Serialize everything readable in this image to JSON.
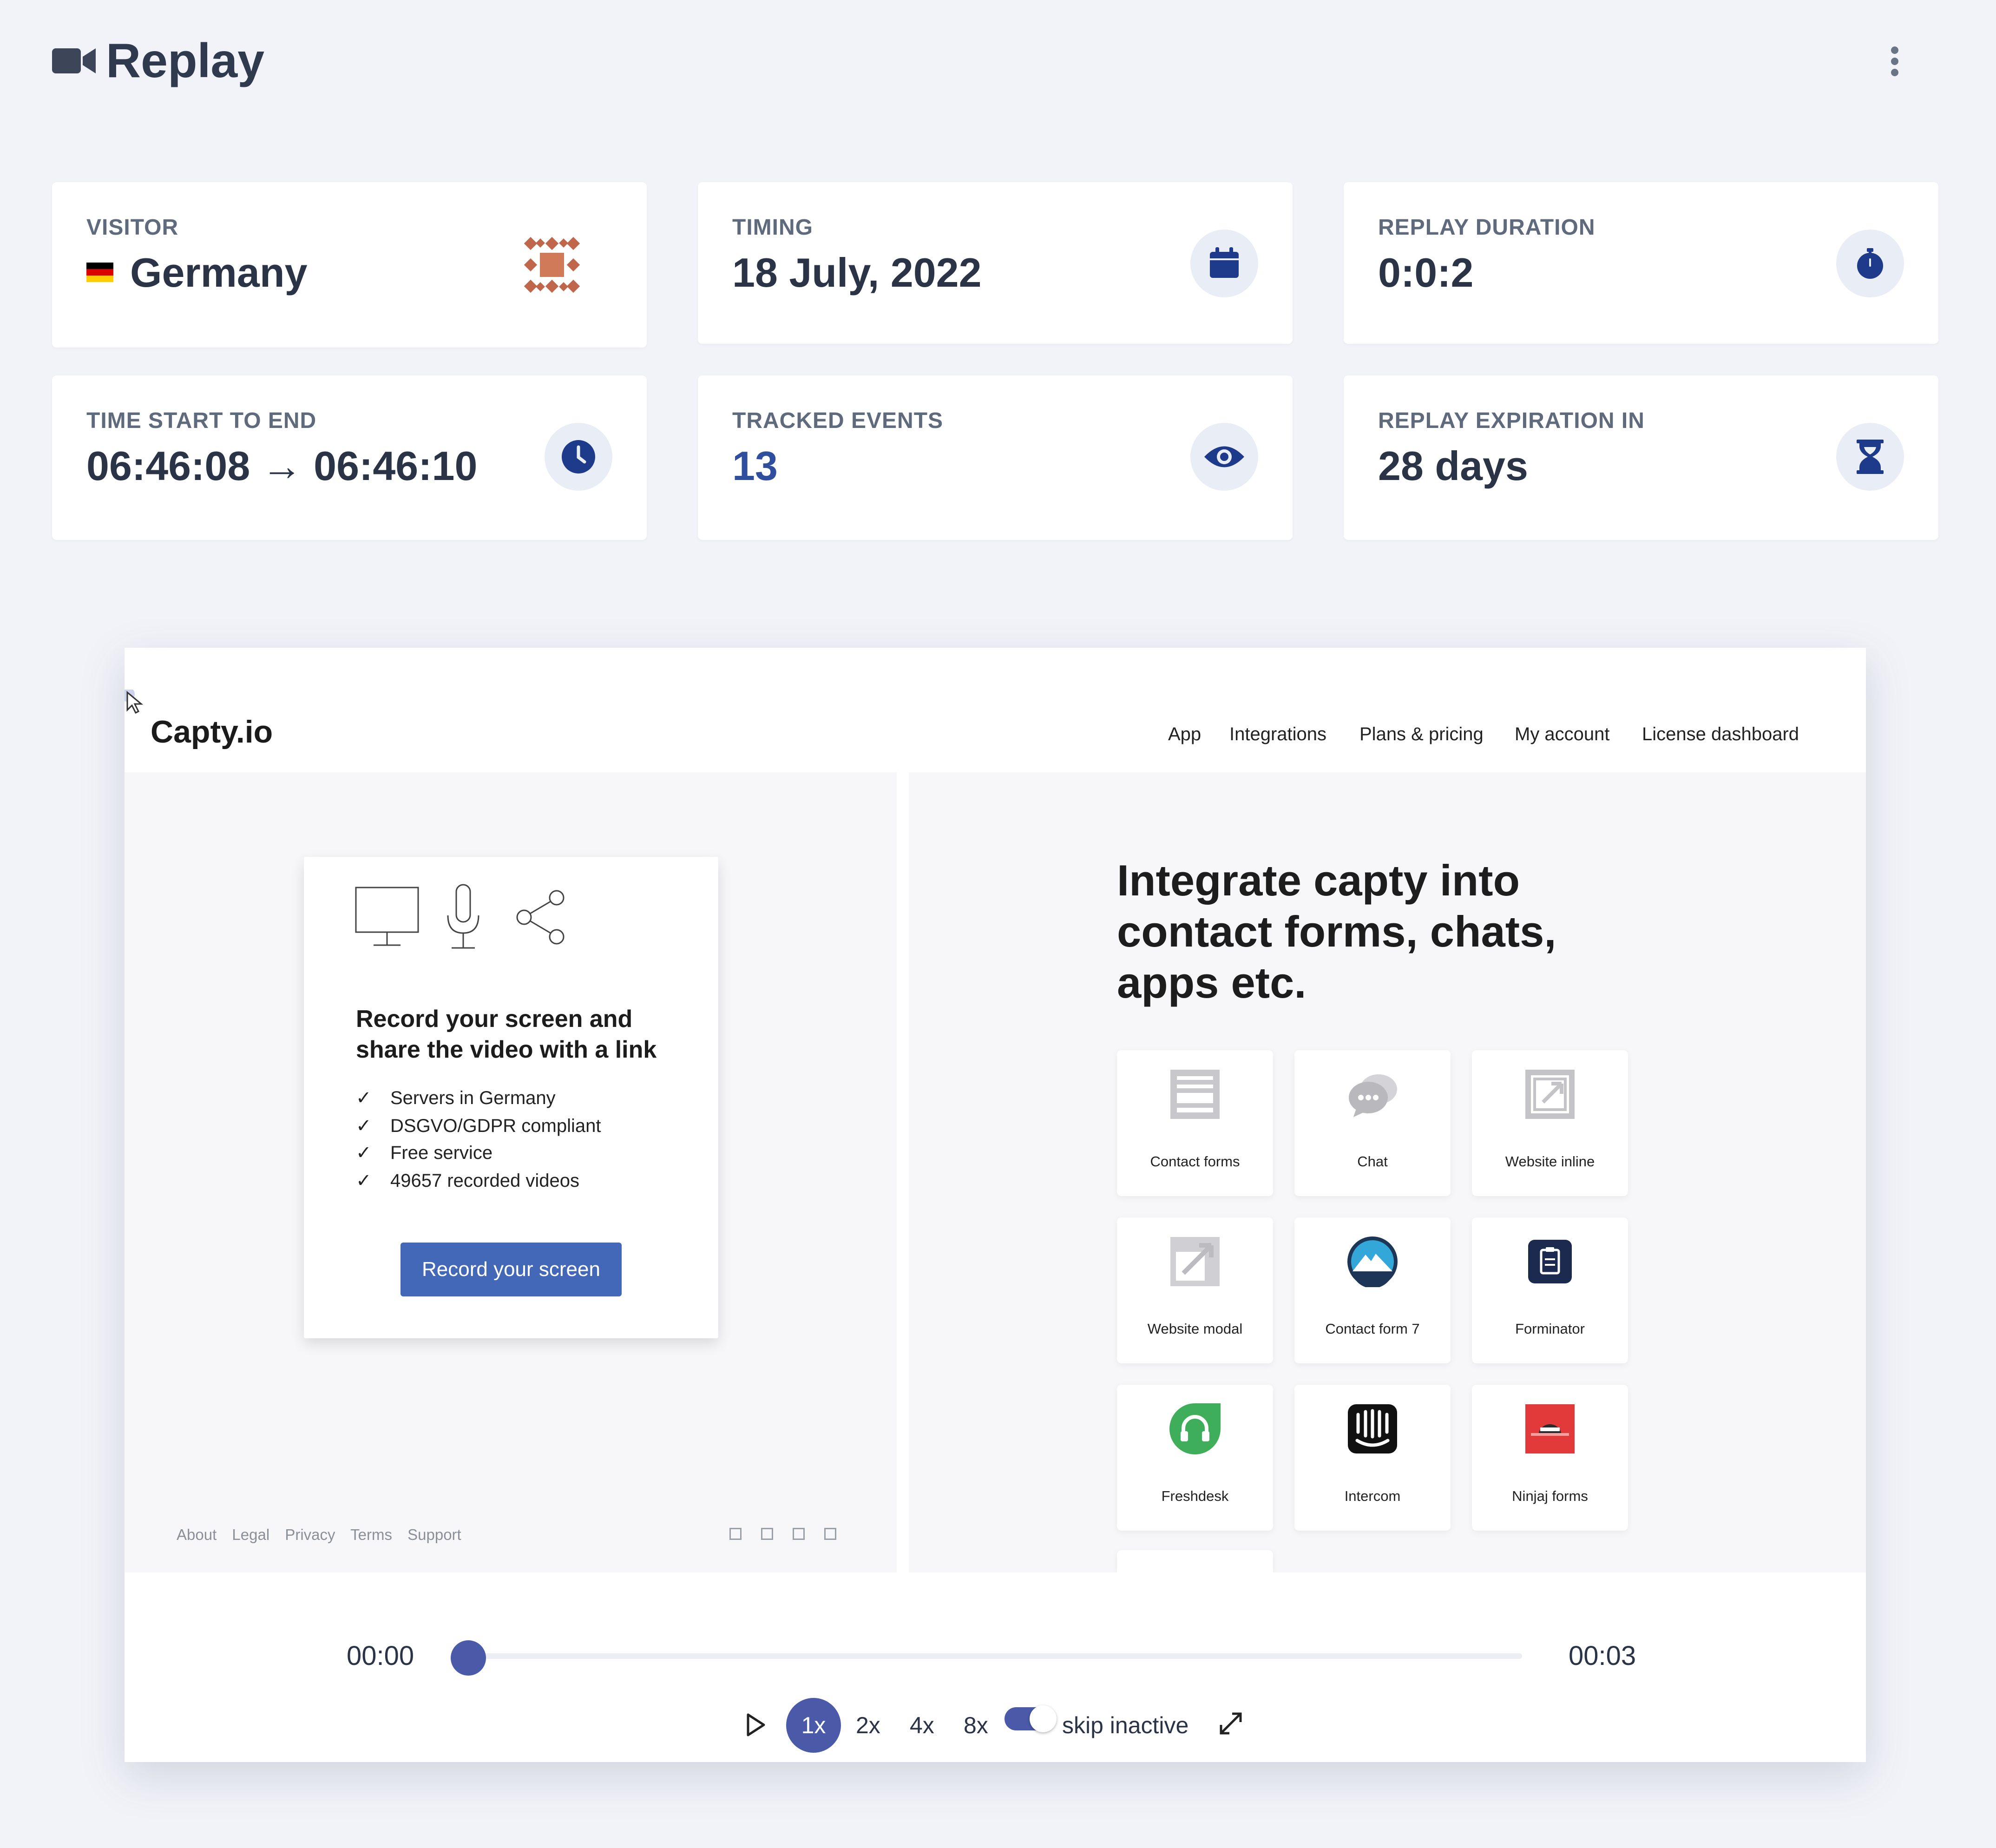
{
  "header": {
    "title": "Replay",
    "icon": "video-camera-icon",
    "menu_icon": "kebab-menu-icon"
  },
  "stats": [
    {
      "label": "VISITOR",
      "value": "Germany",
      "icon": "visitor-avatar-icon",
      "flag": "germany-flag-icon"
    },
    {
      "label": "TIMING",
      "value": "18 July, 2022",
      "icon": "calendar-icon"
    },
    {
      "label": "REPLAY DURATION",
      "value": "0:0:2",
      "icon": "stopwatch-icon"
    },
    {
      "label": "TIME START TO END",
      "value": "06:46:08 → 06:46:10",
      "icon": "clock-icon"
    },
    {
      "label": "TRACKED EVENTS",
      "value": "13",
      "icon": "eye-icon"
    },
    {
      "label": "REPLAY EXPIRATION IN",
      "value": "28 days",
      "icon": "hourglass-icon"
    }
  ],
  "site": {
    "logo": "Capty.io",
    "nav": [
      "App",
      "Integrations",
      "Plans & pricing",
      "My account",
      "License dashboard"
    ],
    "promo": {
      "title": "Record your screen and share the video with a link",
      "checks": [
        "Servers in Germany",
        "DSGVO/GDPR compliant",
        "Free service",
        "49657 recorded videos"
      ],
      "button": "Record your screen"
    },
    "footer_links": [
      "About",
      "Legal",
      "Privacy",
      "Terms",
      "Support"
    ],
    "integrations_heading": "Integrate capty into contact forms, chats, apps etc.",
    "integrations": [
      "Contact forms",
      "Chat",
      "Website inline",
      "Website modal",
      "Contact form 7",
      "Forminator",
      "Freshdesk",
      "Intercom",
      "Ninjaj forms"
    ]
  },
  "player": {
    "current_time": "00:00",
    "total_time": "00:03",
    "progress": 0,
    "speeds": [
      "1x",
      "2x",
      "4x",
      "8x"
    ],
    "active_speed": "1x",
    "skip_inactive_label": "skip inactive",
    "skip_inactive_on": true
  },
  "colors": {
    "accent": "#4a5aa8",
    "navy_icon": "#1e3a8a",
    "card_bg": "#ffffff",
    "page_bg": "#f1f3f8",
    "button_blue": "#4468b8"
  }
}
